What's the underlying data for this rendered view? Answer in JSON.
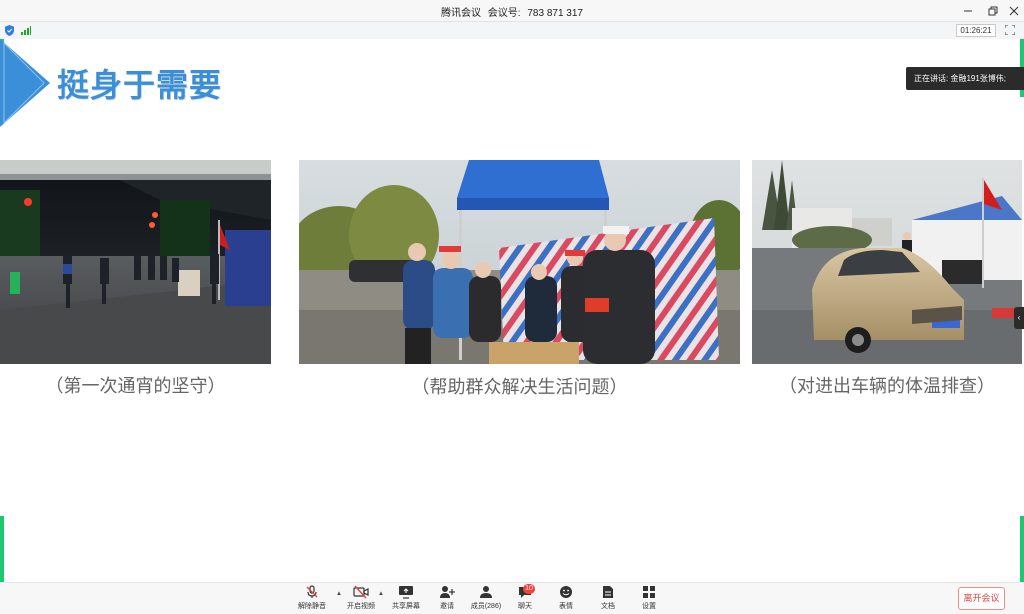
{
  "window": {
    "app_name": "腾讯会议",
    "meeting_id_label": "会议号:",
    "meeting_id": "783 871 317",
    "minimize_icon": "minimize-icon",
    "restore_icon": "restore-icon",
    "close_icon": "close-icon"
  },
  "status": {
    "timer": "01:26:21",
    "shield_icon": "shield-icon",
    "signal_icon": "signal-icon",
    "fullscreen_icon": "fullscreen-icon"
  },
  "slide": {
    "title": "挺身于需要",
    "panels": [
      {
        "caption": "（第一次通宵的坚守）"
      },
      {
        "caption": "（帮助群众解决生活问题）"
      },
      {
        "caption": "（对进出车辆的体温排查）"
      }
    ]
  },
  "speaker": {
    "label": "正在讲话: ",
    "name": "金融191张博伟;"
  },
  "toolbar": {
    "unmute": "解除静音",
    "start_video": "开启视频",
    "share_screen": "共享屏幕",
    "invite": "邀请",
    "members": "成员(286)",
    "chat": "聊天",
    "chat_badge": "10",
    "reactions": "表情",
    "docs": "文档",
    "settings": "设置",
    "leave": "离开会议"
  },
  "colors": {
    "accent": "#3a8fd8",
    "green": "#1ec870",
    "leave_red": "#e64340"
  }
}
